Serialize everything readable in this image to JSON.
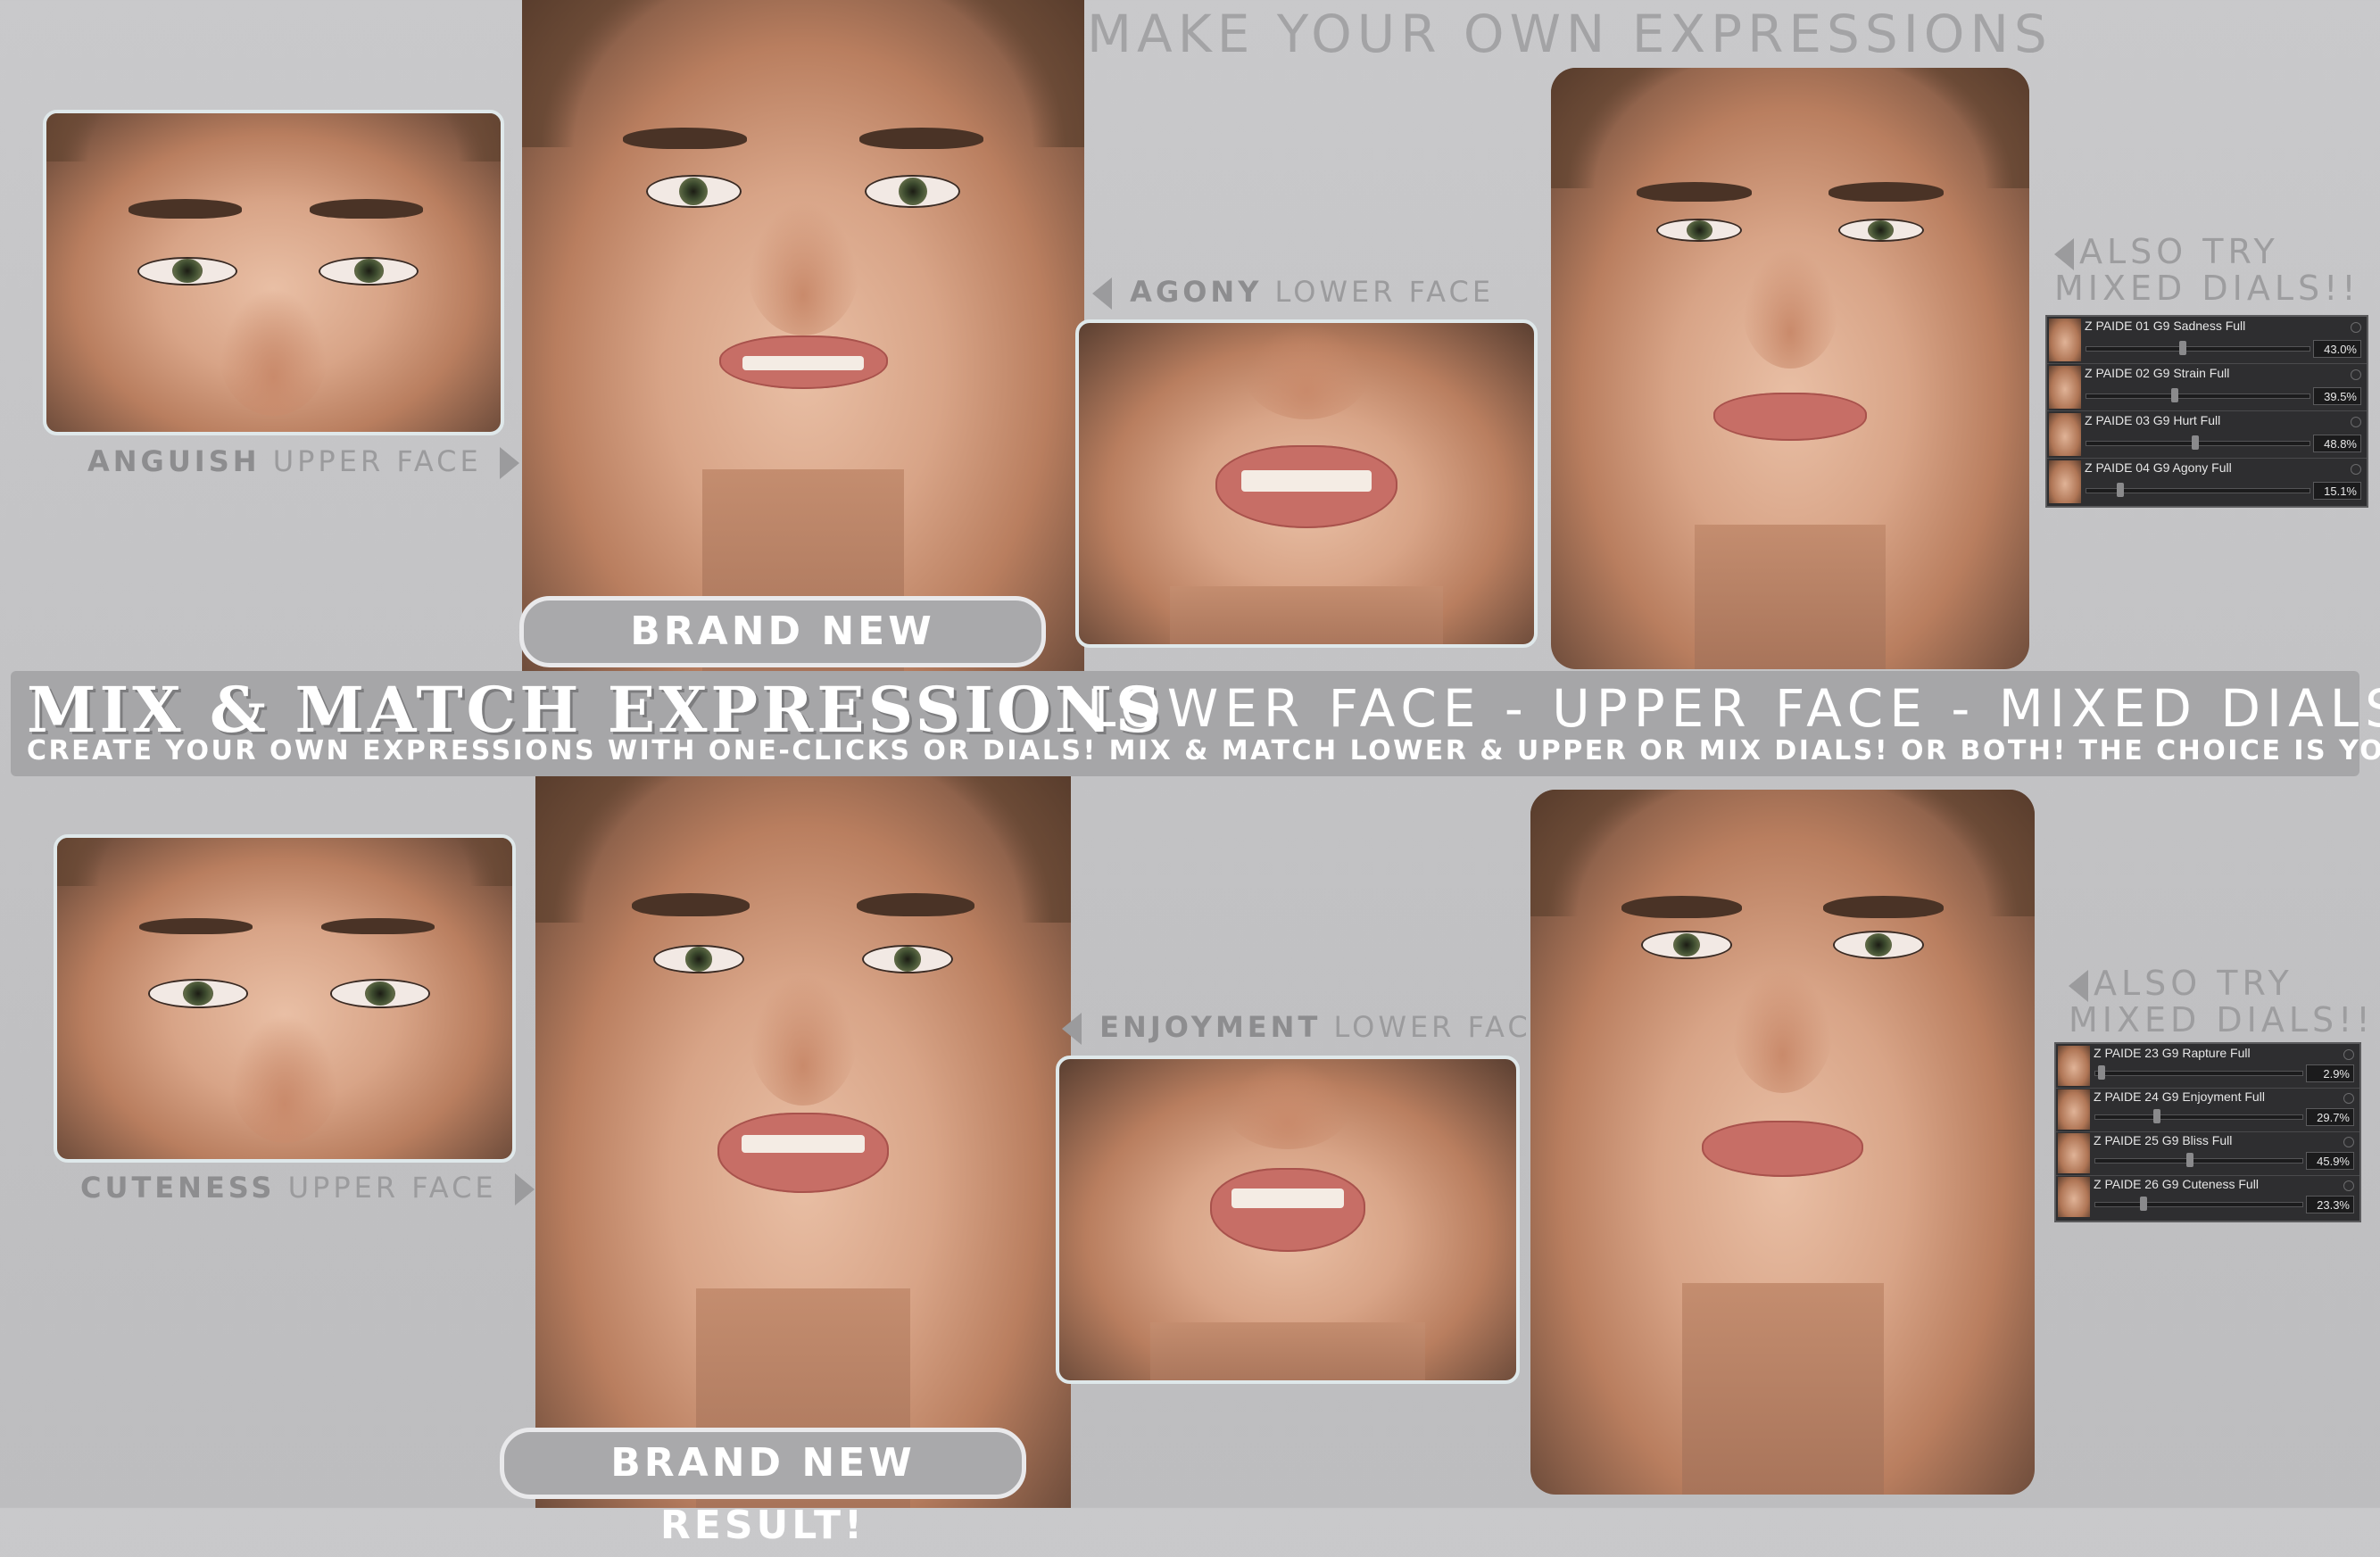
{
  "header": {
    "title": "MAKE YOUR OWN EXPRESSIONS"
  },
  "top_section": {
    "upper_face_label": {
      "name": "ANGUISH",
      "suffix": "UPPER FACE"
    },
    "lower_face_label": {
      "name": "AGONY",
      "suffix": "LOWER FACE"
    },
    "result_button": "BRAND NEW RESULT!",
    "also_try": [
      "ALSO TRY",
      "MIXED DIALS!!"
    ],
    "dials": [
      {
        "name": "Z PAIDE 01 G9 Sadness Full",
        "value": "43.0%",
        "level": 0.43
      },
      {
        "name": "Z PAIDE 02 G9 Strain Full",
        "value": "39.5%",
        "level": 0.395
      },
      {
        "name": "Z PAIDE 03 G9 Hurt Full",
        "value": "48.8%",
        "level": 0.488
      },
      {
        "name": "Z PAIDE 04 G9 Agony Full",
        "value": "15.1%",
        "level": 0.151
      }
    ]
  },
  "banner": {
    "main": "MIX & MATCH EXPRESSIONS",
    "sub": "LOWER FACE - UPPER FACE - MIXED DIALS",
    "description": "CREATE YOUR OWN EXPRESSIONS WITH ONE-CLICKS OR DIALS! MIX & MATCH LOWER & UPPER OR MIX DIALS! OR BOTH! THE CHOICE IS YOURS!"
  },
  "bottom_section": {
    "upper_face_label": {
      "name": "CUTENESS",
      "suffix": "UPPER FACE"
    },
    "lower_face_label": {
      "name": "ENJOYMENT",
      "suffix": "LOWER FACE"
    },
    "result_button": "BRAND NEW RESULT!",
    "also_try": [
      "ALSO TRY",
      "MIXED DIALS!!"
    ],
    "dials": [
      {
        "name": "Z PAIDE 23 G9 Rapture Full",
        "value": "2.9%",
        "level": 0.029
      },
      {
        "name": "Z PAIDE 24 G9 Enjoyment Full",
        "value": "29.7%",
        "level": 0.297
      },
      {
        "name": "Z PAIDE 25 G9 Bliss Full",
        "value": "45.9%",
        "level": 0.459
      },
      {
        "name": "Z PAIDE 26 G9 Cuteness Full",
        "value": "23.3%",
        "level": 0.233
      }
    ]
  },
  "colors": {
    "background": "#c6c6c8",
    "label_gray": "#9b9b9d",
    "banner_bg": "#a6a6a8",
    "frame": "#dfe8ea",
    "dial_bg": "#2e2e30"
  }
}
